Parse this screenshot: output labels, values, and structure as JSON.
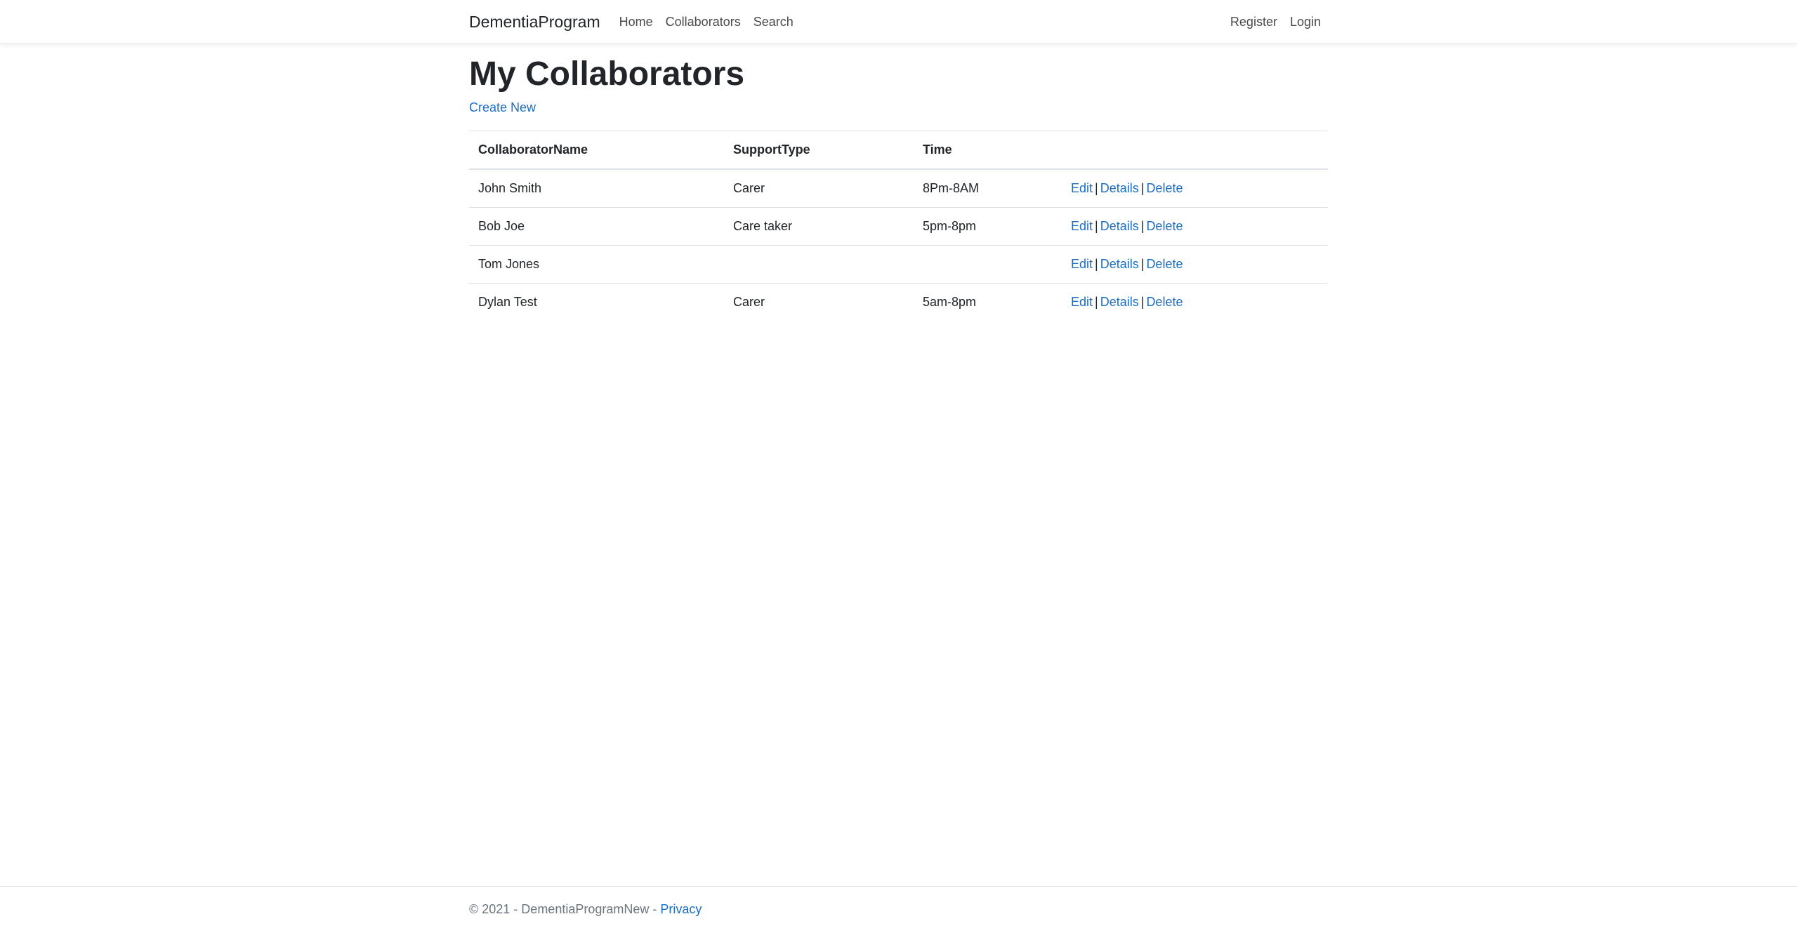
{
  "navbar": {
    "brand": "DementiaProgram",
    "links": [
      "Home",
      "Collaborators",
      "Search"
    ],
    "right_links": [
      "Register",
      "Login"
    ]
  },
  "main": {
    "title": "My Collaborators",
    "create_new": "Create New",
    "table": {
      "headers": [
        "CollaboratorName",
        "SupportType",
        "Time",
        ""
      ],
      "rows": [
        {
          "name": "John Smith",
          "support": "Carer",
          "time": "8Pm-8AM"
        },
        {
          "name": "Bob Joe",
          "support": "Care taker",
          "time": "5pm-8pm"
        },
        {
          "name": "Tom Jones",
          "support": "",
          "time": ""
        },
        {
          "name": "Dylan Test",
          "support": "Carer",
          "time": "5am-8pm"
        }
      ],
      "actions": {
        "edit": "Edit",
        "details": "Details",
        "delete": "Delete",
        "separator": "|"
      }
    }
  },
  "footer": {
    "text": "© 2021 - DementiaProgramNew - ",
    "privacy": "Privacy"
  },
  "colors": {
    "link": "#1b6ec2",
    "text": "#212529",
    "border": "#dee2e6",
    "muted": "#6c757d"
  }
}
